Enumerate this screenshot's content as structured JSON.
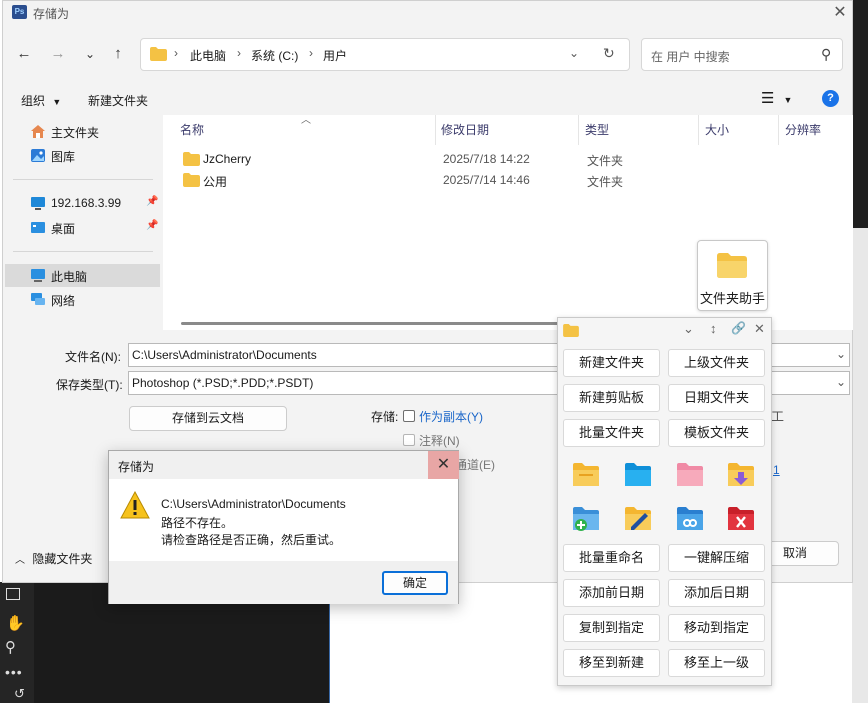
{
  "save_dialog": {
    "title": "存储为",
    "app_badge": "Ps",
    "address": [
      "此电脑",
      "系统 (C:)",
      "用户"
    ],
    "search_placeholder": "在 用户 中搜索",
    "toolbar": {
      "organize": "组织",
      "new_folder": "新建文件夹"
    },
    "nav_items": [
      {
        "label": "主文件夹",
        "icon": "home-icon"
      },
      {
        "label": "图库",
        "icon": "gallery-icon"
      },
      {
        "label": "192.168.3.99",
        "icon": "monitor-icon"
      },
      {
        "label": "桌面",
        "icon": "desktop-icon"
      },
      {
        "label": "此电脑",
        "icon": "computer-icon"
      },
      {
        "label": "网络",
        "icon": "network-icon"
      }
    ],
    "columns": [
      "名称",
      "修改日期",
      "类型",
      "大小",
      "分辨率"
    ],
    "files": [
      {
        "name": "JzCherry",
        "date": "2025/7/18 14:22",
        "type": "文件夹"
      },
      {
        "name": "公用",
        "date": "2025/7/14 14:46",
        "type": "文件夹"
      }
    ],
    "filename_label": "文件名(N):",
    "filename_value": "C:\\Users\\Administrator\\Documents",
    "filetype_label": "保存类型(T):",
    "filetype_value": "Photoshop (*.PSD;*.PDD;*.PSDT)",
    "save_cloud": "存储到云文档",
    "save_label": "存储:",
    "as_copy": "作为副本(Y)",
    "notes": "注释(N)",
    "channels_partial": "通道(E)",
    "hide_folders": "隐藏文件夹",
    "cancel": "取消",
    "right_partial_char": "工",
    "right_partial_num": "1"
  },
  "helper_tile": {
    "label": "文件夹助手"
  },
  "helper_panel": {
    "buttons_top": [
      "新建文件夹",
      "上级文件夹",
      "新建剪贴板",
      "日期文件夹",
      "批量文件夹",
      "模板文件夹"
    ],
    "buttons_bottom": [
      "批量重命名",
      "一键解压缩",
      "添加前日期",
      "添加后日期",
      "复制到指定",
      "移动到指定",
      "移至到新建",
      "移至上一级"
    ]
  },
  "error_dialog": {
    "title": "存储为",
    "line1": "C:\\Users\\Administrator\\Documents",
    "line2": "路径不存在。",
    "line3": "请检查路径是否正确，然后重试。",
    "ok": "确定"
  },
  "colors": {
    "accent": "#0a6fd8",
    "folder": "#f4c244",
    "close_hover": "#e8a6a5",
    "link": "#1a66c9"
  }
}
